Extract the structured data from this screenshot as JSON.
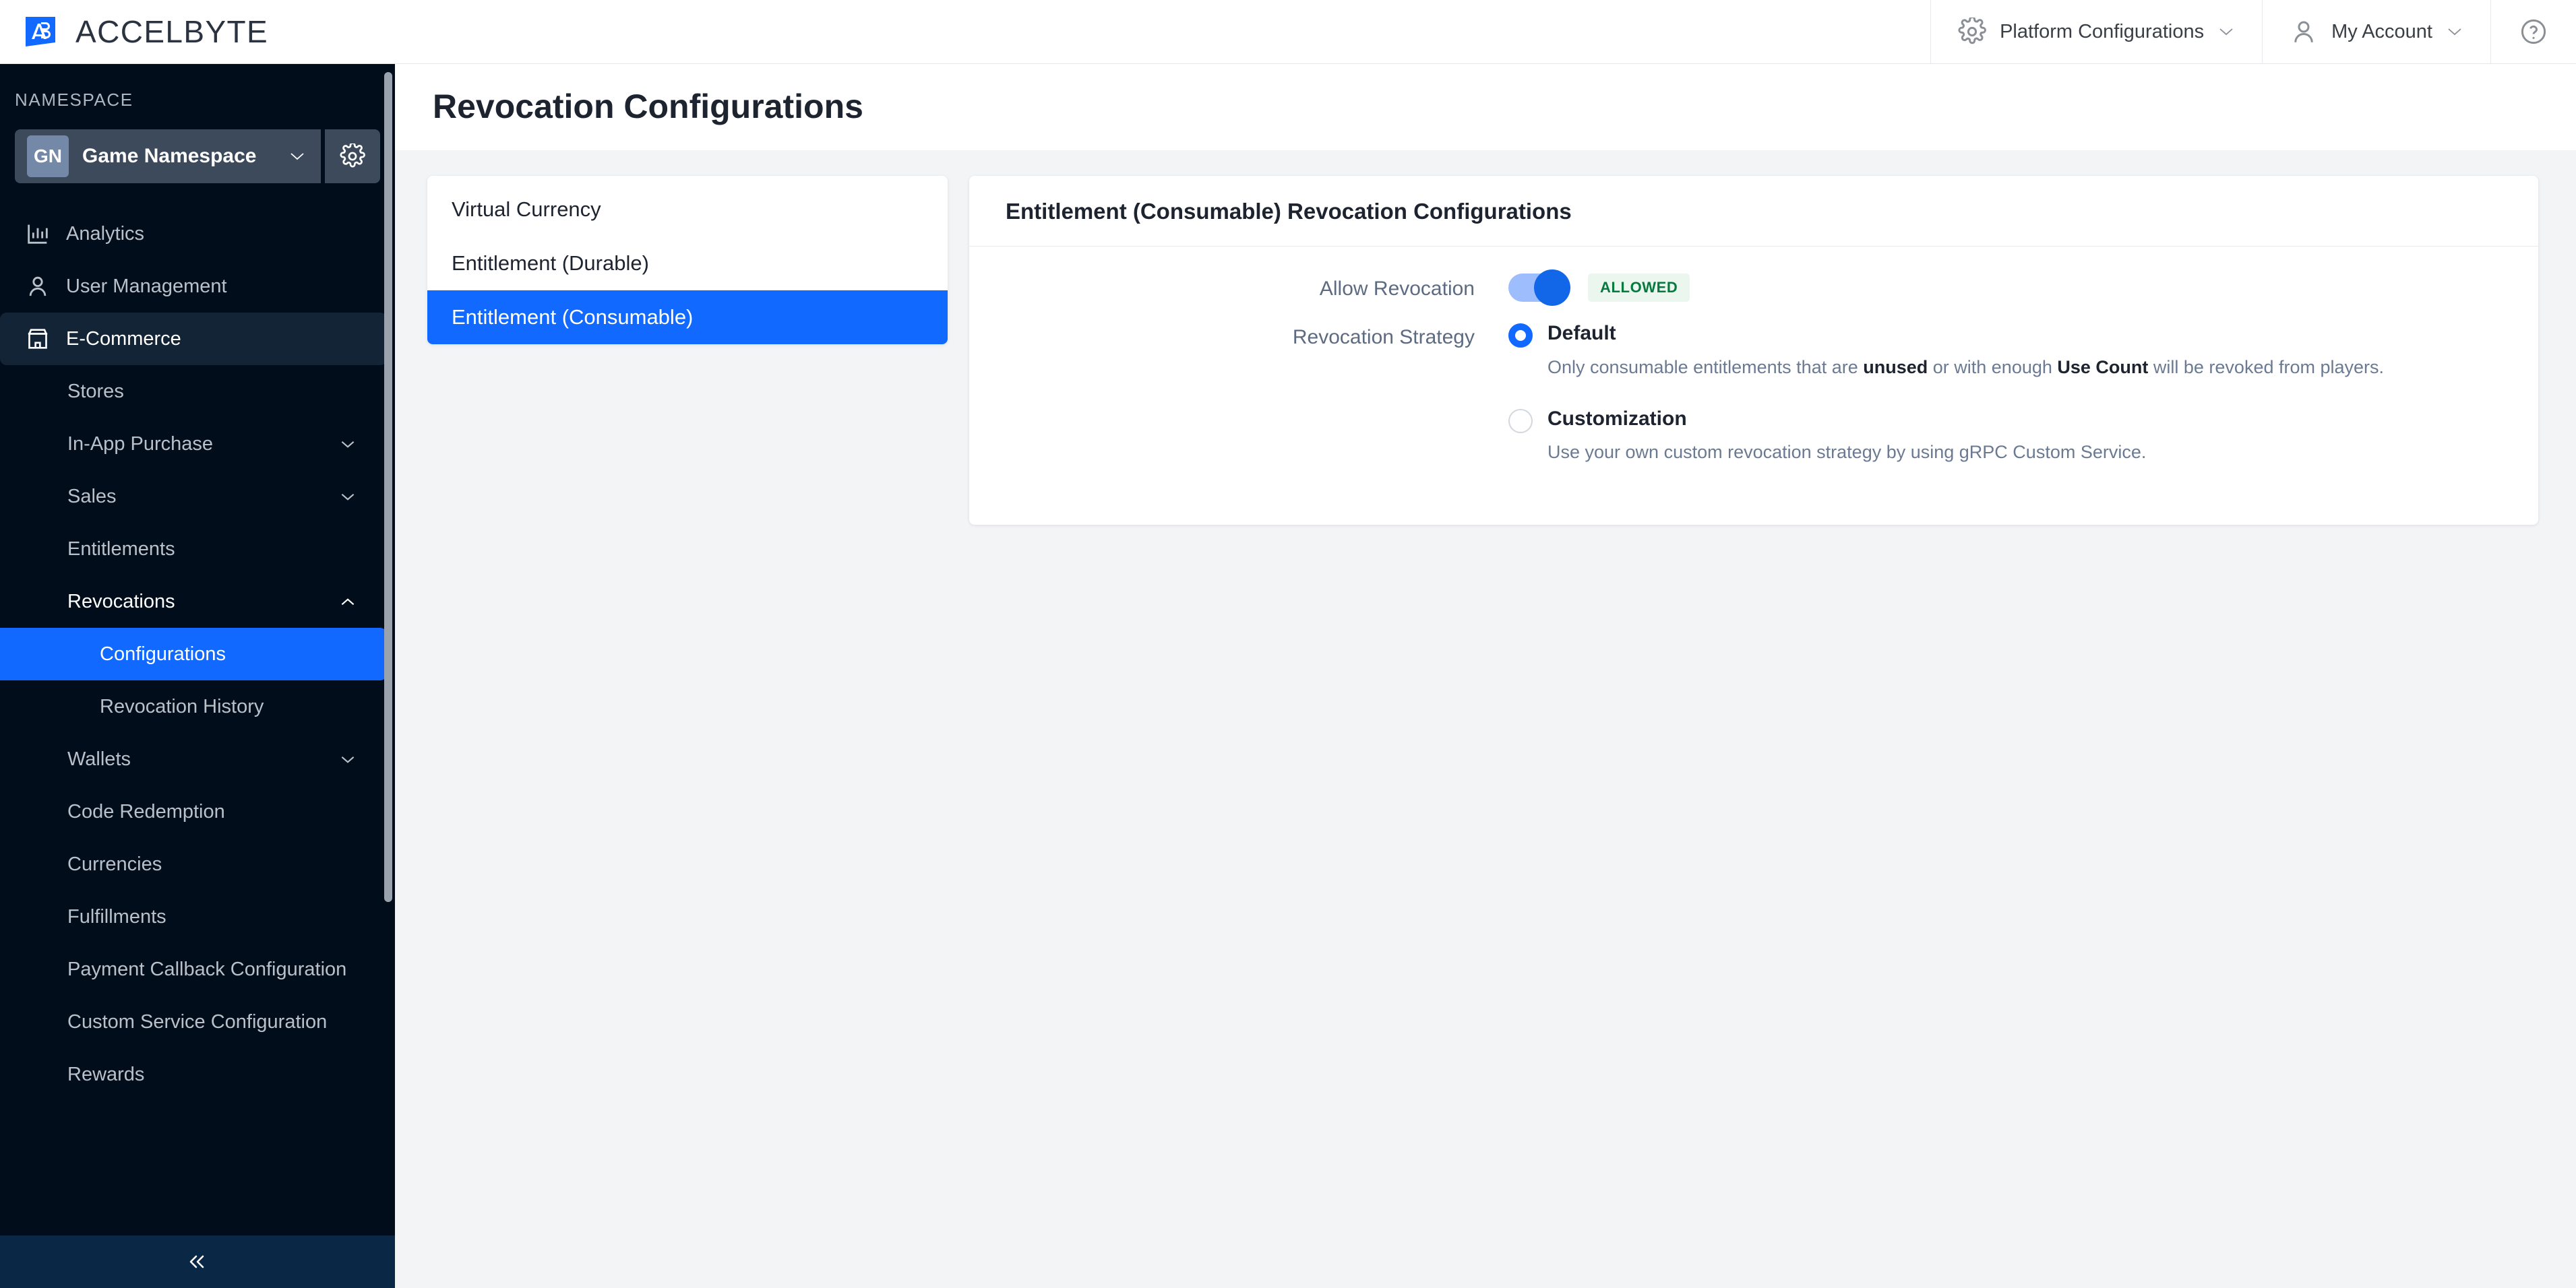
{
  "brand": {
    "name": "ACCELBYTE",
    "logo_initials": "AB",
    "accent": "#1269ff"
  },
  "topbar": {
    "platform_configurations": "Platform Configurations",
    "my_account": "My Account",
    "help": "?"
  },
  "sidebar": {
    "namespace_label": "NAMESPACE",
    "namespace_initials": "GN",
    "namespace_name": "Game Namespace",
    "items": [
      {
        "label": "Analytics",
        "icon": "chart-icon",
        "level": 0,
        "state": "idle"
      },
      {
        "label": "User Management",
        "icon": "user-icon",
        "level": 0,
        "state": "idle"
      },
      {
        "label": "E-Commerce",
        "icon": "store-icon",
        "level": 0,
        "state": "active-parent"
      },
      {
        "label": "Stores",
        "level": 1,
        "state": "idle"
      },
      {
        "label": "In-App Purchase",
        "level": 1,
        "state": "collapsed"
      },
      {
        "label": "Sales",
        "level": 1,
        "state": "collapsed"
      },
      {
        "label": "Entitlements",
        "level": 1,
        "state": "idle"
      },
      {
        "label": "Revocations",
        "level": 1,
        "state": "expanded"
      },
      {
        "label": "Configurations",
        "level": 2,
        "state": "selected"
      },
      {
        "label": "Revocation History",
        "level": 2,
        "state": "idle"
      },
      {
        "label": "Wallets",
        "level": 1,
        "state": "collapsed"
      },
      {
        "label": "Code Redemption",
        "level": 1,
        "state": "idle"
      },
      {
        "label": "Currencies",
        "level": 1,
        "state": "idle"
      },
      {
        "label": "Fulfillments",
        "level": 1,
        "state": "idle"
      },
      {
        "label": "Payment Callback Configuration",
        "level": 1,
        "state": "idle"
      },
      {
        "label": "Custom Service Configuration",
        "level": 1,
        "state": "idle"
      },
      {
        "label": "Rewards",
        "level": 1,
        "state": "idle"
      }
    ],
    "collapse_icon": "chevrons-left-icon"
  },
  "main": {
    "page_title": "Revocation Configurations",
    "tabs": [
      {
        "label": "Virtual Currency",
        "active": false
      },
      {
        "label": "Entitlement (Durable)",
        "active": false
      },
      {
        "label": "Entitlement (Consumable)",
        "active": true
      }
    ],
    "panel": {
      "title": "Entitlement (Consumable) Revocation Configurations",
      "allow_revocation": {
        "label": "Allow Revocation",
        "enabled": true,
        "badge": "ALLOWED",
        "badge_color": "#067a3e",
        "badge_bg": "#eaf6ee"
      },
      "revocation_strategy": {
        "label": "Revocation Strategy",
        "selected": "Default",
        "options": [
          {
            "label": "Default",
            "selected": true,
            "desc_part1": "Only consumable entitlements that are ",
            "desc_bold1": "unused",
            "desc_part2": " or with enough ",
            "desc_bold2": "Use Count",
            "desc_part3": " will be revoked from players."
          },
          {
            "label": "Customization",
            "selected": false,
            "desc_part1": "Use your own custom revocation strategy by using gRPC Custom Service.",
            "desc_bold1": "",
            "desc_part2": "",
            "desc_bold2": "",
            "desc_part3": ""
          }
        ]
      }
    }
  }
}
